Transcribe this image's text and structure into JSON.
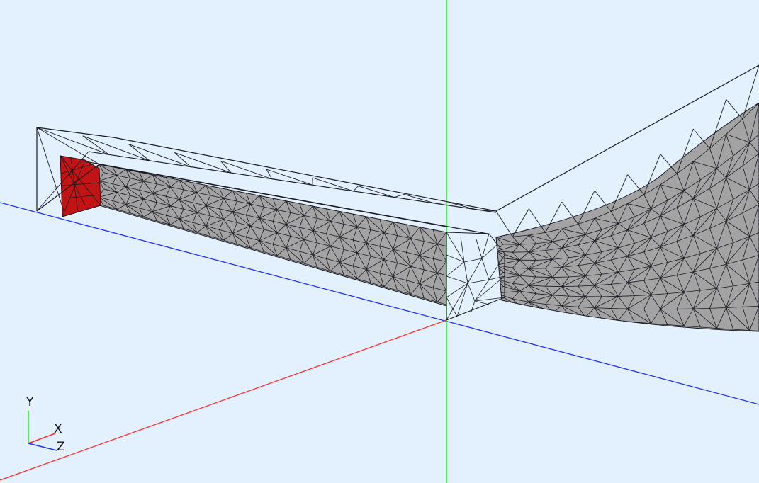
{
  "viewport": {
    "background": "#e3f0fd",
    "mesh_fill": "#a3a3a3",
    "mesh_stroke": "#1a1a24",
    "selected_face_fill": "#c21414"
  },
  "scene_axes": {
    "x_color": "#ff3030",
    "y_color": "#30e030",
    "z_color": "#2030ff"
  },
  "orientation_triad": {
    "x_label": "X",
    "y_label": "Y",
    "z_label": "Z"
  }
}
